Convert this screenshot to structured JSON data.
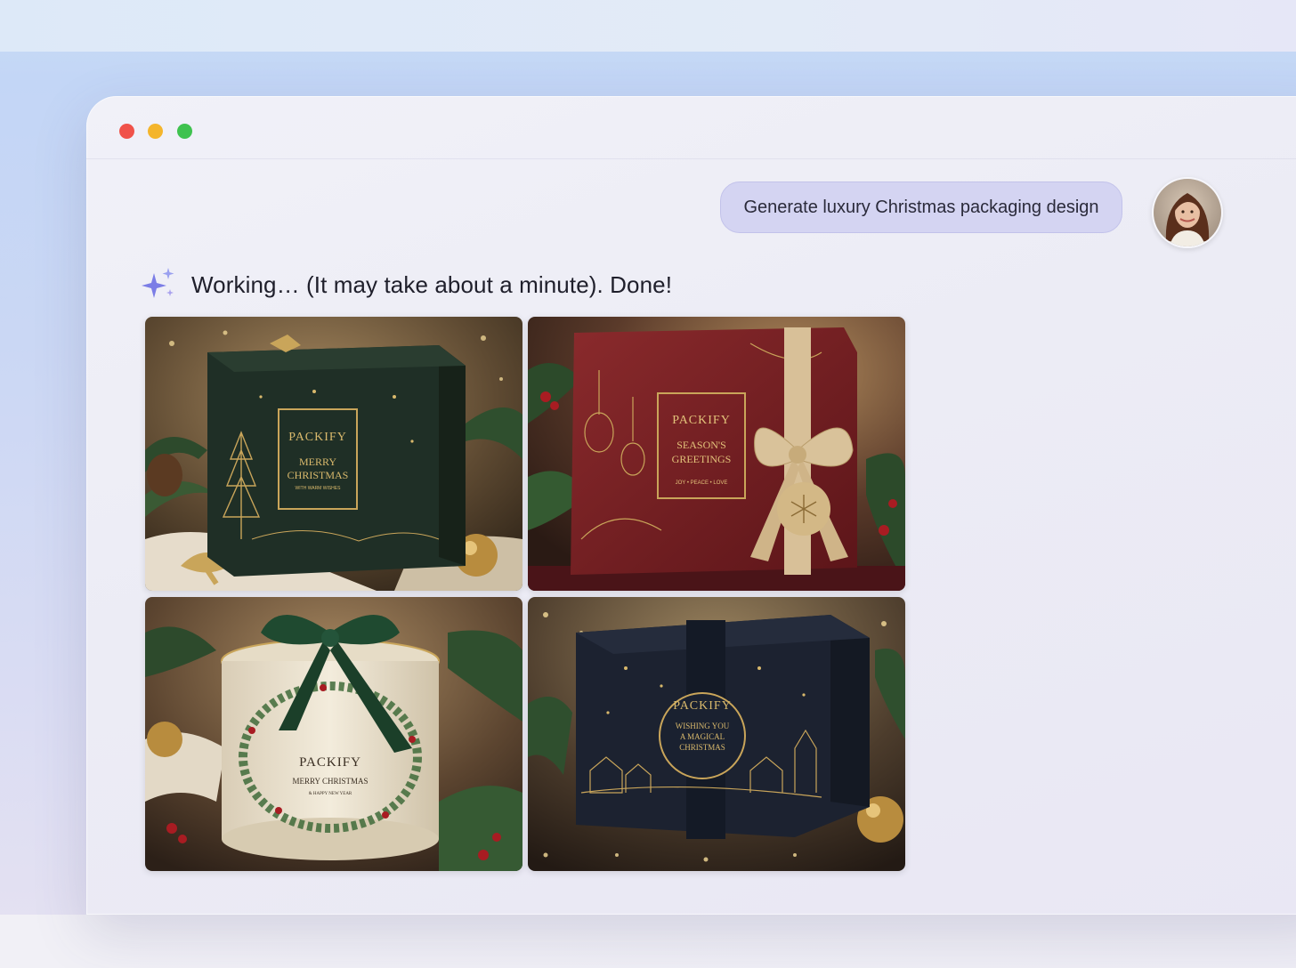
{
  "window": {
    "controls": [
      "close",
      "minimize",
      "maximize"
    ]
  },
  "chat": {
    "user_message": "Generate luxury Christmas packaging design",
    "status_text": "Working… (It may take about a minute). Done!",
    "status_icon": "sparkle-icon"
  },
  "images": [
    {
      "brand": "PACKIFY",
      "line1": "MERRY",
      "line2": "CHRISTMAS",
      "tagline": "WITH WARM WISHES"
    },
    {
      "brand": "PACKIFY",
      "line1": "SEASON'S",
      "line2": "GREETINGS",
      "tagline": "JOY • PEACE • LOVE"
    },
    {
      "brand": "PACKIFY",
      "line1": "MERRY CHRISTMAS",
      "tagline": "& HAPPY NEW YEAR"
    },
    {
      "brand": "PACKIFY",
      "line1": "WISHING YOU",
      "line2": "A MAGICAL",
      "line3": "CHRISTMAS"
    }
  ],
  "colors": {
    "bubble": "#d4d4f2",
    "sparkle": "#7b7de6",
    "green_box": "#1f2f26",
    "red_box": "#7a1f24",
    "cream_box": "#efe6d4",
    "navy_box": "#1c2230",
    "gold": "#c9a55a"
  }
}
